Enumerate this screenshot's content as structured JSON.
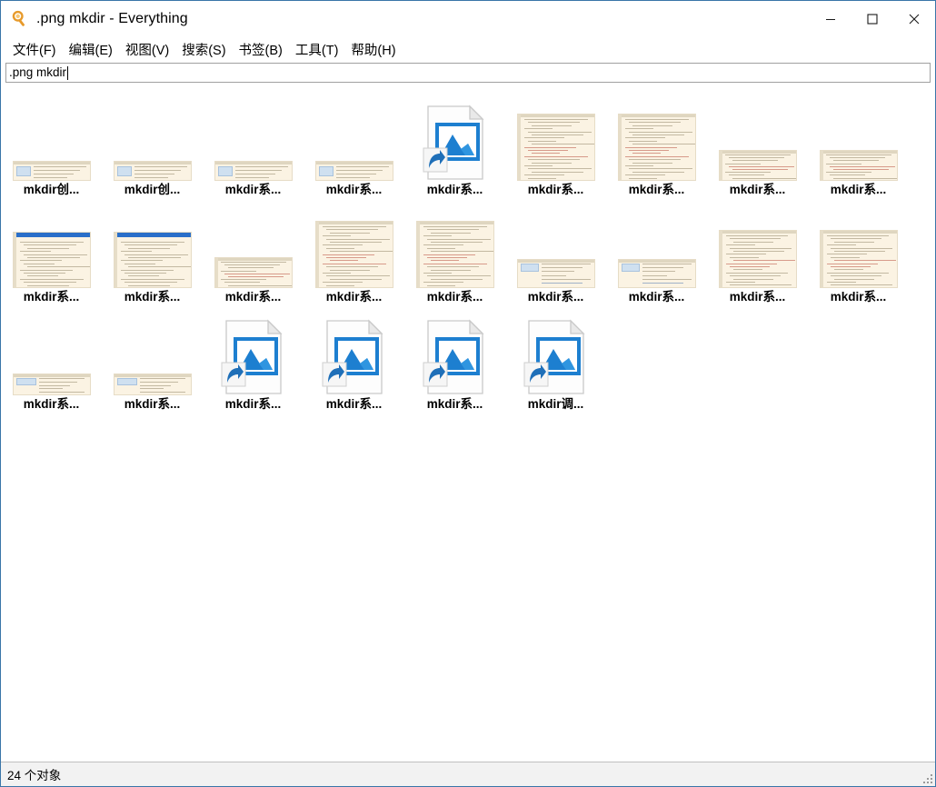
{
  "window": {
    "title": ".png mkdir - Everything",
    "app_icon": "magnifier-icon",
    "accent_border": "#3a76a8",
    "controls": {
      "minimize": "minimize-icon",
      "maximize": "maximize-icon",
      "close": "close-icon"
    }
  },
  "menubar": {
    "items": [
      {
        "label": "文件(F)"
      },
      {
        "label": "编辑(E)"
      },
      {
        "label": "视图(V)"
      },
      {
        "label": "搜索(S)"
      },
      {
        "label": "书签(B)"
      },
      {
        "label": "工具(T)"
      },
      {
        "label": "帮助(H)"
      }
    ]
  },
  "search": {
    "value": ".png mkdir",
    "placeholder": ""
  },
  "results": {
    "view_mode": "thumbnails",
    "items": [
      {
        "label": "mkdir创...",
        "thumb": "doc-table-cream"
      },
      {
        "label": "mkdir创...",
        "thumb": "doc-table-cream"
      },
      {
        "label": "mkdir系...",
        "thumb": "doc-table-cream"
      },
      {
        "label": "mkdir系...",
        "thumb": "doc-table-cream"
      },
      {
        "label": "mkdir系...",
        "thumb": "picture-shortcut-icon"
      },
      {
        "label": "mkdir系...",
        "thumb": "doc-code-tall"
      },
      {
        "label": "mkdir系...",
        "thumb": "doc-code-tall"
      },
      {
        "label": "mkdir系...",
        "thumb": "doc-terminal-short"
      },
      {
        "label": "mkdir系...",
        "thumb": "doc-terminal-short"
      },
      {
        "label": "mkdir系...",
        "thumb": "doc-browser-blue"
      },
      {
        "label": "mkdir系...",
        "thumb": "doc-browser-blue"
      },
      {
        "label": "mkdir系...",
        "thumb": "doc-terminal-short"
      },
      {
        "label": "mkdir系...",
        "thumb": "doc-code-tall"
      },
      {
        "label": "mkdir系...",
        "thumb": "doc-code-tall"
      },
      {
        "label": "mkdir系...",
        "thumb": "doc-table-wide"
      },
      {
        "label": "mkdir系...",
        "thumb": "doc-table-wide"
      },
      {
        "label": "mkdir系...",
        "thumb": "doc-code-mid"
      },
      {
        "label": "mkdir系...",
        "thumb": "doc-code-mid"
      },
      {
        "label": "mkdir系...",
        "thumb": "doc-table-small"
      },
      {
        "label": "mkdir系...",
        "thumb": "doc-table-small"
      },
      {
        "label": "mkdir系...",
        "thumb": "picture-shortcut-icon"
      },
      {
        "label": "mkdir系...",
        "thumb": "picture-shortcut-icon"
      },
      {
        "label": "mkdir系...",
        "thumb": "picture-shortcut-icon"
      },
      {
        "label": "mkdir调...",
        "thumb": "picture-shortcut-icon"
      }
    ]
  },
  "statusbar": {
    "object_count_text": "24 个对象",
    "resize_grip": "resize-grip-icon"
  }
}
